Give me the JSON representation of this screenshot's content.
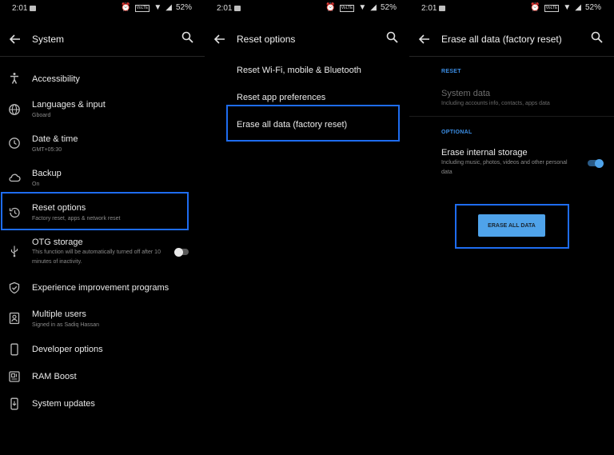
{
  "status": {
    "time": "2:01",
    "network_badge": "VoLTE",
    "battery": "52%"
  },
  "panel1": {
    "title": "System",
    "items": [
      {
        "label": "Accessibility",
        "sub": "",
        "icon": "accessibility-icon"
      },
      {
        "label": "Languages & input",
        "sub": "Gboard",
        "icon": "globe-icon"
      },
      {
        "label": "Date & time",
        "sub": "GMT+05:30",
        "icon": "clock-icon"
      },
      {
        "label": "Backup",
        "sub": "On",
        "icon": "cloud-icon"
      },
      {
        "label": "Reset options",
        "sub": "Factory reset, apps & network reset",
        "icon": "history-icon"
      },
      {
        "label": "OTG storage",
        "sub": "This function will be automatically turned off after 10 minutes of inactivity.",
        "icon": "usb-icon"
      },
      {
        "label": "Experience improvement programs",
        "sub": "",
        "icon": "shield-check-icon"
      },
      {
        "label": "Multiple users",
        "sub": "Signed in as Sadiq Hassan",
        "icon": "user-icon"
      },
      {
        "label": "Developer options",
        "sub": "",
        "icon": "phone-icon"
      },
      {
        "label": "RAM Boost",
        "sub": "",
        "icon": "ram-icon"
      },
      {
        "label": "System updates",
        "sub": "",
        "icon": "system-update-icon"
      }
    ],
    "otg_toggle": "off"
  },
  "panel2": {
    "title": "Reset options",
    "items": [
      {
        "label": "Reset Wi-Fi, mobile & Bluetooth"
      },
      {
        "label": "Reset app preferences"
      },
      {
        "label": "Erase all data (factory reset)"
      }
    ]
  },
  "panel3": {
    "title": "Erase all data (factory reset)",
    "section_reset": "RESET",
    "system_data": {
      "label": "System data",
      "sub": "Including accounts info, contacts, apps data"
    },
    "section_optional": "OPTIONAL",
    "internal_storage": {
      "label": "Erase internal storage",
      "sub": "Including music, photos, videos and other personal data",
      "toggle": "on"
    },
    "button": "ERASE ALL DATA"
  },
  "colors": {
    "background": "#000000",
    "highlight": "#1e6cf0",
    "accent": "#4fa3ea",
    "section": "#3c8fe6"
  }
}
